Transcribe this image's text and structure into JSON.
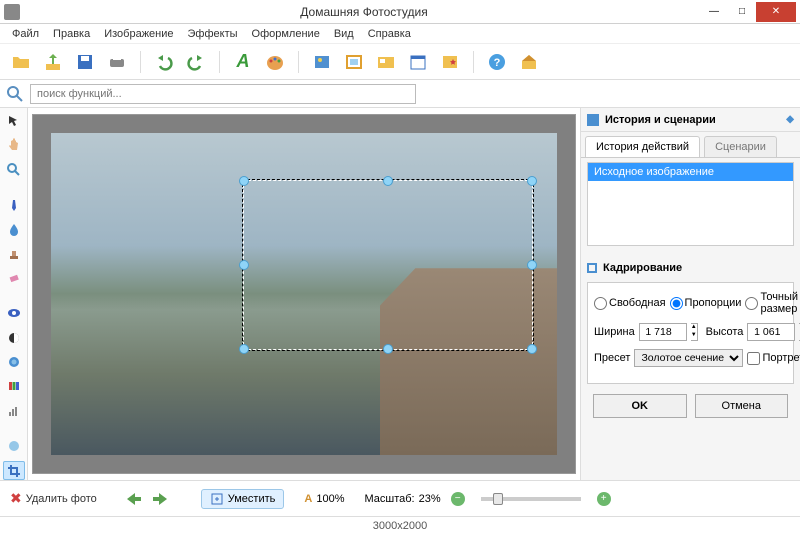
{
  "window": {
    "title": "Домашняя Фотостудия"
  },
  "menu": [
    "Файл",
    "Правка",
    "Изображение",
    "Эффекты",
    "Оформление",
    "Вид",
    "Справка"
  ],
  "toolbar_icons": [
    "open-folder",
    "save-up",
    "save-disk",
    "print",
    "undo",
    "redo",
    "text-a",
    "palette",
    "image-sun",
    "image-frame",
    "browse",
    "calendar",
    "image-star",
    "help",
    "home"
  ],
  "search": {
    "placeholder": "поиск функций..."
  },
  "toolstrip_icons": [
    "pointer",
    "hand",
    "zoom",
    "brush",
    "drop",
    "stamp",
    "eraser",
    "eye",
    "contrast",
    "lens",
    "rgb-bars",
    "levels",
    "blur",
    "crop"
  ],
  "rightpanel": {
    "history_title": "История и сценарии",
    "tabs": {
      "history": "История действий",
      "scenarios": "Сценарии"
    },
    "history_item": "Исходное изображение",
    "crop_title": "Кадрирование",
    "modes": {
      "free": "Свободная",
      "prop": "Пропорции",
      "exact": "Точный размер"
    },
    "width_label": "Ширина",
    "width_value": "1 718",
    "height_label": "Высота",
    "height_value": "1 061",
    "preset_label": "Пресет",
    "preset_value": "Золотое сечение",
    "portrait_label": "Портретные",
    "ok": "OK",
    "cancel": "Отмена"
  },
  "bottom": {
    "delete": "Удалить фото",
    "fit": "Уместить",
    "zoom100_icon": "A",
    "zoom100_value": "100%",
    "scale_label": "Масштаб:",
    "scale_value": "23%"
  },
  "status": {
    "dimensions": "3000x2000"
  }
}
